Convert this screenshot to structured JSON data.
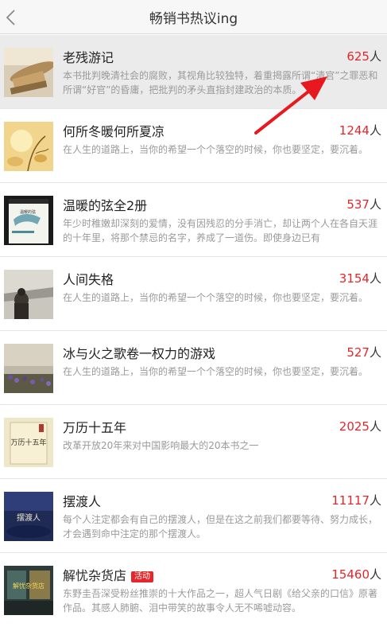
{
  "header": {
    "title": "畅销书热议ing"
  },
  "items": [
    {
      "title": "老残游记",
      "count": "625",
      "unit": "人",
      "desc": "本书批判晚清社会的腐败，其视角比较独特，着重揭露所谓“清官”之罪恶和所谓“好官”的昏庸，把批判的矛头直指封建政治的本质。"
    },
    {
      "title": "何所冬暖何所夏凉",
      "count": "1244",
      "unit": "人",
      "desc": "在人生的道路上，当你的希望一个个落空的时候，你也要坚定，要沉着。"
    },
    {
      "title": "温暖的弦全2册",
      "count": "537",
      "unit": "人",
      "desc": "年少时稚嫩却深刻的爱情，没有因残忍的分手消亡，却让两个人在各自天涯的十年里，将那个禁忌的名字，养成了一道伤。即使身边已有"
    },
    {
      "title": "人间失格",
      "count": "3154",
      "unit": "人",
      "desc": "在人生的道路上，当你的希望一个个落空的时候，你也要坚定，要沉着。"
    },
    {
      "title": "冰与火之歌卷一权力的游戏",
      "count": "527",
      "unit": "人",
      "desc": "在人生的道路上，当你的希望一个个落空的时候，你也要坚定，要沉着。"
    },
    {
      "title": "万历十五年",
      "count": "2025",
      "unit": "人",
      "desc": "改革开放20年来对中国影响最大的20本书之一"
    },
    {
      "title": "摆渡人",
      "count": "11117",
      "unit": "人",
      "desc": "每个人注定都会有自己的摆渡人，但是在这之前我们都要等待、努力成长，才会遇到命中注定的那个摆渡人。"
    },
    {
      "title": "解忧杂货店",
      "count": "15460",
      "unit": "人",
      "tag": "活动",
      "desc": "东野圭吾深受粉丝推崇的十大作品之一，超人气日剧《给父亲的口信》原著作品。其感人肺腑、泪中带笑的故事令人无不唏嘘动容。"
    }
  ],
  "covers": {
    "item2": {
      "title": "温暖的弦"
    },
    "item5": {
      "title": "万历十五年"
    },
    "item6": {
      "title": "摆渡人"
    },
    "item7": {
      "title": "解忧杂货店"
    }
  },
  "colors": {
    "accent": "#e5262b",
    "annotation": "#e8191e"
  }
}
